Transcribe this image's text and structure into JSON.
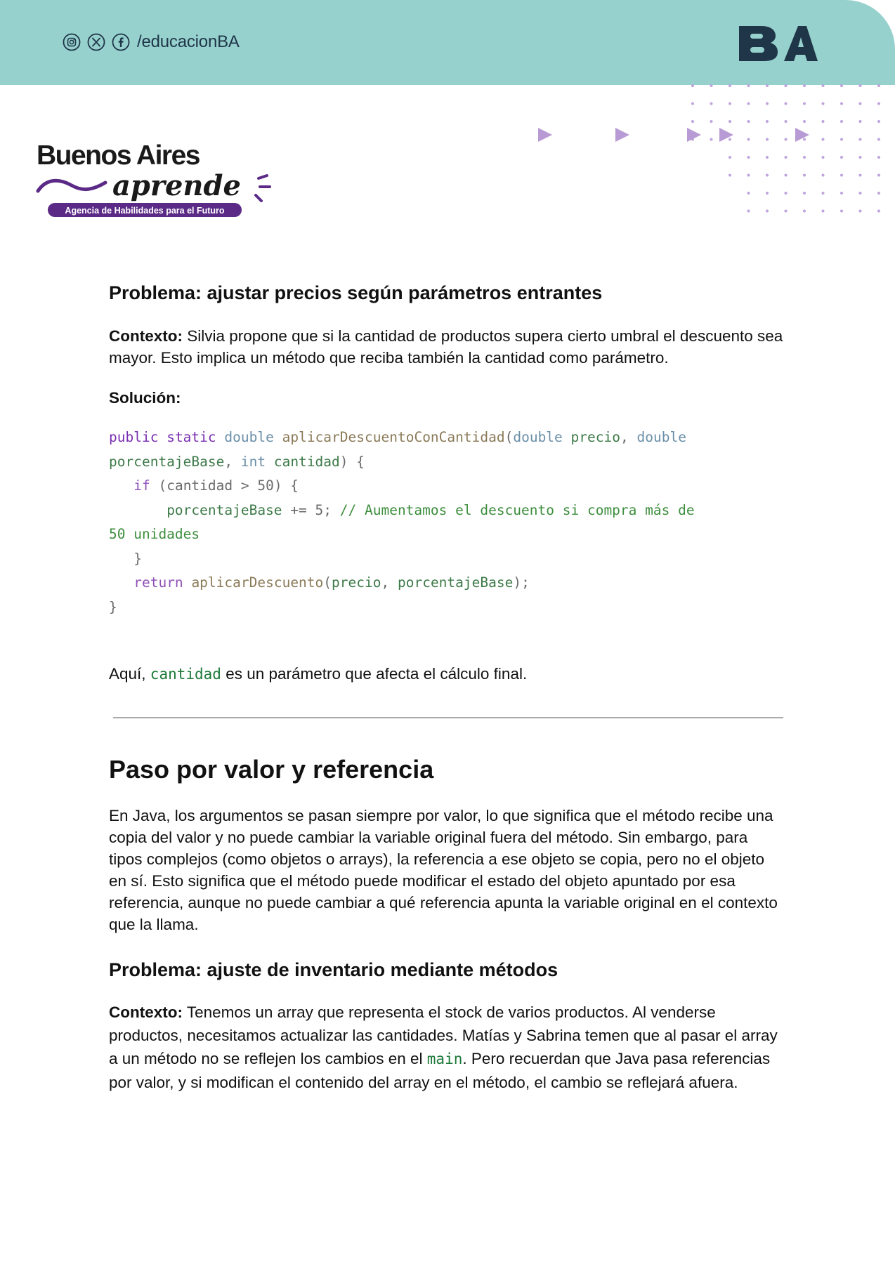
{
  "header": {
    "social_handle": "/educacionBA",
    "social_icons": [
      "instagram-icon",
      "x-icon",
      "facebook-icon"
    ],
    "ba_logo": "BA",
    "colors": {
      "banner": "#96d1cd",
      "navy": "#1f3548",
      "purple": "#5b2a86",
      "dot_purple": "#b57fd6"
    }
  },
  "brand": {
    "line1": "Buenos Aires",
    "line2": "aprende",
    "tagline": "Agencia de Habilidades para el Futuro"
  },
  "section1": {
    "title": "Problema: ajustar precios según parámetros entrantes",
    "context_label": "Contexto:",
    "context_text": " Silvia propone que si la cantidad de productos supera cierto umbral el descuento sea mayor. Esto implica un método que reciba también la cantidad como parámetro.",
    "solution_label": "Solución:",
    "code": {
      "l1": {
        "public": "public",
        "static": "static",
        "double1": "double",
        "fn": "aplicarDescuentoConCantidad",
        "paren": "(",
        "double2": "double",
        "precio": "precio",
        "comma": ",",
        "double3": "double"
      },
      "l2": {
        "param": "porcentajeBase",
        "comma": ",",
        "int": "int",
        "cantidad": "cantidad",
        "close": ") {"
      },
      "l3": {
        "if": "if",
        "cond": "(cantidad > 50) {"
      },
      "l4": {
        "param": "porcentajeBase",
        "op": "+= 5;",
        "comment": "// Aumentamos el descuento si compra más de"
      },
      "l5": {
        "comment": "50 unidades"
      },
      "l6": {
        "brace": "}"
      },
      "l7": {
        "return": "return",
        "fn": "aplicarDescuento",
        "open": "(",
        "precio": "precio",
        "comma": ",",
        "param": "porcentajeBase",
        "close": ");"
      },
      "l8": {
        "brace": "}"
      }
    },
    "after_pre": "Aquí, ",
    "after_code": "cantidad",
    "after_post": " es un parámetro que afecta el cálculo final."
  },
  "section2": {
    "title": "Paso por valor y referencia",
    "body": "En Java, los argumentos se pasan siempre por valor, lo que significa que el método recibe una copia del valor y no puede cambiar la variable original fuera del método. Sin embargo, para tipos complejos (como objetos o arrays), la referencia a ese objeto se copia, pero no el objeto en sí. Esto significa que el método puede modificar el estado del objeto apuntado por esa referencia, aunque no puede cambiar a qué referencia apunta la variable original en el contexto que la llama."
  },
  "section3": {
    "title": "Problema: ajuste de inventario mediante métodos",
    "context_label": "Contexto:",
    "context_pre": " Tenemos un array que representa el stock de varios productos. Al venderse productos, necesitamos actualizar las cantidades. Matías y Sabrina temen que al pasar el array a un método no se reflejen los cambios en el ",
    "context_code": "main",
    "context_post": ". Pero recuerdan que Java pasa referencias por valor, y si modifican el contenido del array en el método, el cambio se reflejará afuera."
  }
}
